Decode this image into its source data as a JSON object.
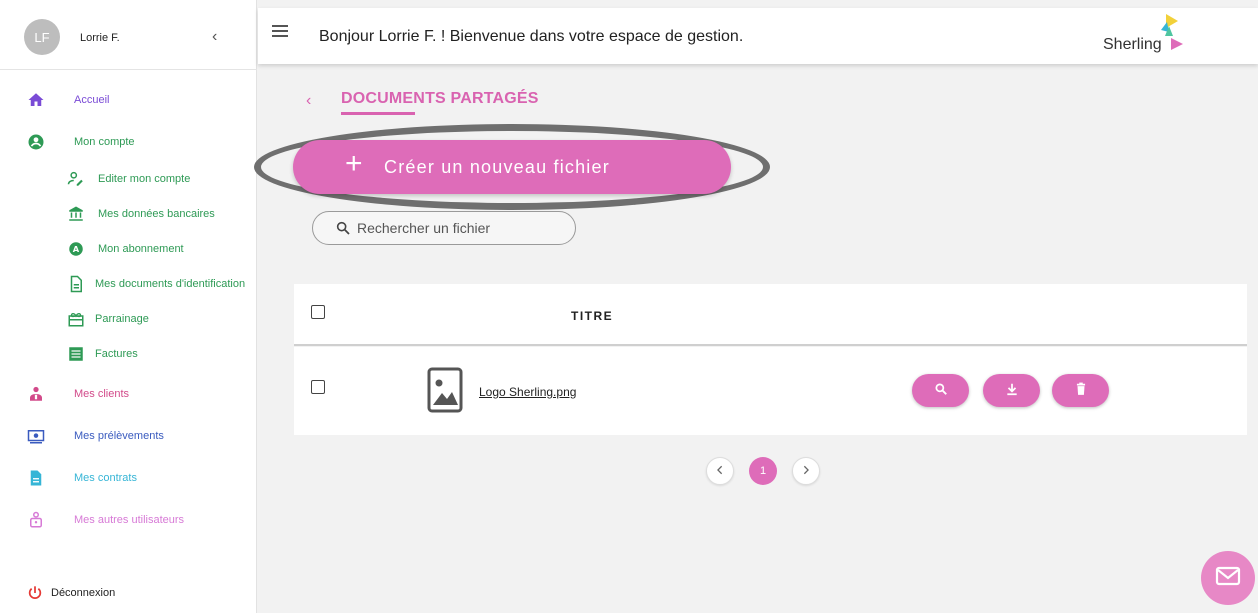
{
  "user": {
    "initials": "LF",
    "name": "Lorrie F."
  },
  "header": {
    "welcome": "Bonjour Lorrie F. ! Bienvenue dans votre espace de gestion.",
    "logo_text": "Sherling"
  },
  "sidebar": {
    "items": [
      {
        "label": "Accueil",
        "icon": "home-icon",
        "color": "#7a4bd6"
      },
      {
        "label": "Mon compte",
        "icon": "account-circle-icon",
        "color": "#2e9a55"
      },
      {
        "label": "Editer mon compte",
        "icon": "edit-user-icon",
        "color": "#2e9a55"
      },
      {
        "label": "Mes données bancaires",
        "icon": "bank-icon",
        "color": "#2e9a55"
      },
      {
        "label": "Mon abonnement",
        "icon": "subscription-icon",
        "color": "#2e9a55"
      },
      {
        "label": "Mes documents d'identification",
        "icon": "document-icon",
        "color": "#2e9a55"
      },
      {
        "label": "Parrainage",
        "icon": "gift-icon",
        "color": "#2e9a55"
      },
      {
        "label": "Factures",
        "icon": "invoice-icon",
        "color": "#2e9a55"
      },
      {
        "label": "Mes clients",
        "icon": "clients-icon",
        "color": "#d24a8a"
      },
      {
        "label": "Mes prélèvements",
        "icon": "money-icon",
        "color": "#3a5bbf"
      },
      {
        "label": "Mes contrats",
        "icon": "contract-icon",
        "color": "#36b5d6"
      },
      {
        "label": "Mes autres utilisateurs",
        "icon": "users-icon",
        "color": "#d77ad6"
      }
    ],
    "logout": "Déconnexion"
  },
  "main": {
    "title": "DOCUMENTS PARTAGÉS",
    "create_button": "Créer un nouveau fichier",
    "search_placeholder": "Rechercher un fichier",
    "table": {
      "column_title": "TITRE",
      "rows": [
        {
          "name": "Logo Sherling.png"
        }
      ]
    },
    "pagination": {
      "current": "1"
    }
  },
  "colors": {
    "accent": "#de6cb9",
    "accent_dark": "#d963b0"
  }
}
